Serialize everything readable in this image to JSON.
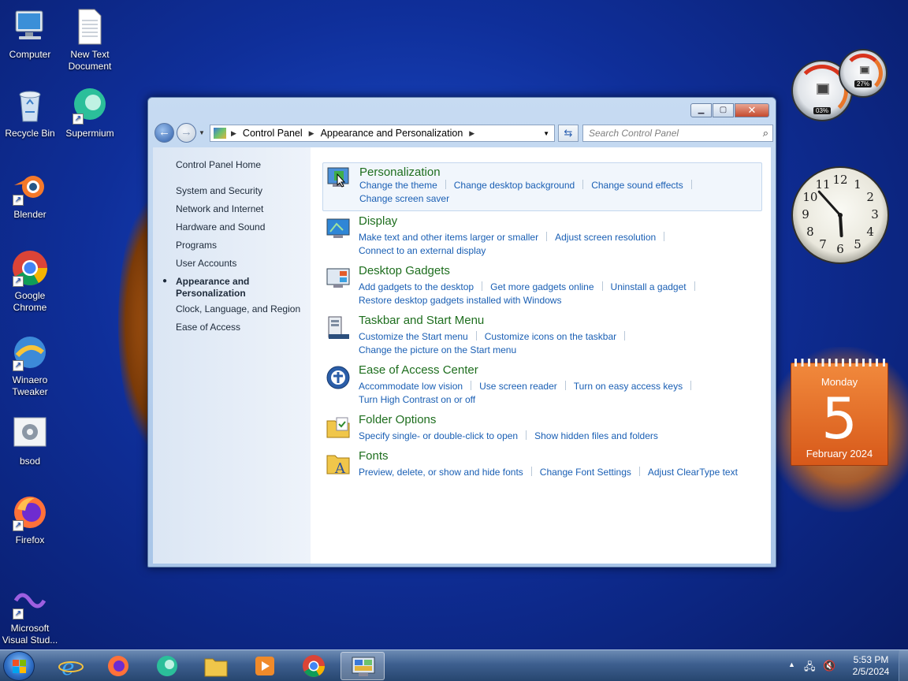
{
  "desktop": {
    "icons": [
      {
        "label": "Computer",
        "icon": "computer-icon"
      },
      {
        "label": "New Text Document",
        "icon": "text-document-icon"
      },
      {
        "label": "Recycle Bin",
        "icon": "recycle-bin-icon"
      },
      {
        "label": "Supermium",
        "icon": "supermium-icon"
      },
      {
        "label": "Blender",
        "icon": "blender-icon"
      },
      {
        "label": "Google Chrome",
        "icon": "chrome-icon"
      },
      {
        "label": "Winaero Tweaker",
        "icon": "winaero-icon"
      },
      {
        "label": "bsod",
        "icon": "bsod-icon"
      },
      {
        "label": "Firefox",
        "icon": "firefox-icon"
      },
      {
        "label": "Microsoft Visual Stud...",
        "icon": "visual-studio-icon"
      }
    ]
  },
  "window": {
    "breadcrumb": [
      "Control Panel",
      "Appearance and Personalization"
    ],
    "search_placeholder": "Search Control Panel",
    "sidebar": {
      "home": "Control Panel Home",
      "items": [
        "System and Security",
        "Network and Internet",
        "Hardware and Sound",
        "Programs",
        "User Accounts",
        "Appearance and Personalization",
        "Clock, Language, and Region",
        "Ease of Access"
      ],
      "active_index": 5
    },
    "categories": [
      {
        "title": "Personalization",
        "icon": "personalization-icon",
        "links": [
          "Change the theme",
          "Change desktop background",
          "Change sound effects",
          "Change screen saver"
        ]
      },
      {
        "title": "Display",
        "icon": "display-icon",
        "links": [
          "Make text and other items larger or smaller",
          "Adjust screen resolution",
          "Connect to an external display"
        ]
      },
      {
        "title": "Desktop Gadgets",
        "icon": "gadgets-icon",
        "links": [
          "Add gadgets to the desktop",
          "Get more gadgets online",
          "Uninstall a gadget",
          "Restore desktop gadgets installed with Windows"
        ]
      },
      {
        "title": "Taskbar and Start Menu",
        "icon": "taskbar-icon",
        "links": [
          "Customize the Start menu",
          "Customize icons on the taskbar",
          "Change the picture on the Start menu"
        ]
      },
      {
        "title": "Ease of Access Center",
        "icon": "ease-of-access-icon",
        "links": [
          "Accommodate low vision",
          "Use screen reader",
          "Turn on easy access keys",
          "Turn High Contrast on or off"
        ]
      },
      {
        "title": "Folder Options",
        "icon": "folder-options-icon",
        "links": [
          "Specify single- or double-click to open",
          "Show hidden files and folders"
        ]
      },
      {
        "title": "Fonts",
        "icon": "fonts-icon",
        "links": [
          "Preview, delete, or show and hide fonts",
          "Change Font Settings",
          "Adjust ClearType text"
        ]
      }
    ]
  },
  "gadgets": {
    "cpu_meter": {
      "cpu": "03%",
      "memory": "27%",
      "cpu_value": 3,
      "memory_value": 27
    },
    "clock": {
      "numbers": [
        "12",
        "1",
        "2",
        "3",
        "4",
        "5",
        "6",
        "7",
        "8",
        "9",
        "10",
        "11"
      ],
      "hours": 5,
      "minutes": 53
    },
    "calendar": {
      "day": "Monday",
      "date": "5",
      "month": "February 2024"
    }
  },
  "taskbar": {
    "items": [
      "internet-explorer-icon",
      "firefox-icon",
      "supermium-icon",
      "file-explorer-icon",
      "media-player-icon",
      "chrome-icon",
      "control-panel-icon"
    ],
    "time": "5:53 PM",
    "date": "2/5/2024",
    "colors": {
      "accent": "#1a5fb4",
      "category_title": "#1e6e1e"
    }
  }
}
